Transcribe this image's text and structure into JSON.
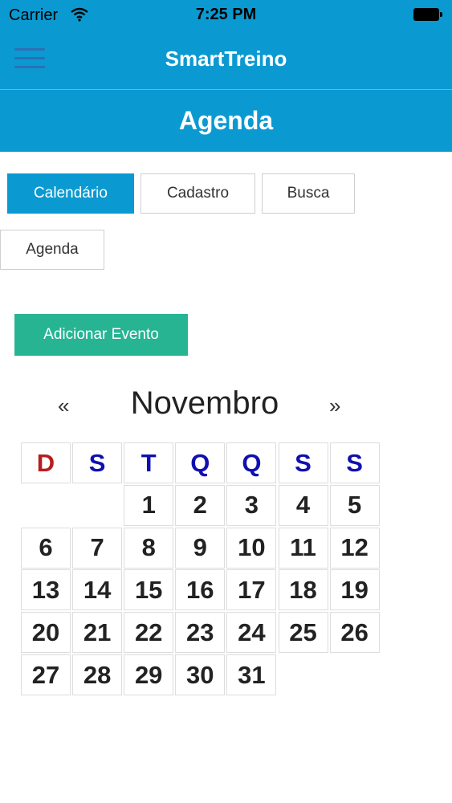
{
  "status_bar": {
    "carrier": "Carrier",
    "time": "7:25 PM"
  },
  "app": {
    "title": "SmartTreino"
  },
  "section": {
    "title": "Agenda"
  },
  "tabs": [
    {
      "label": "Calendário",
      "active": true
    },
    {
      "label": "Cadastro",
      "active": false
    },
    {
      "label": "Busca",
      "active": false
    },
    {
      "label": "Agenda",
      "active": false
    }
  ],
  "actions": {
    "add_event": "Adicionar Evento"
  },
  "calendar": {
    "prev": "«",
    "next": "»",
    "month": "Novembro",
    "weekdays": [
      "D",
      "S",
      "T",
      "Q",
      "Q",
      "S",
      "S"
    ],
    "first_weekday_index": 2,
    "days": [
      "1",
      "2",
      "3",
      "4",
      "5",
      "6",
      "7",
      "8",
      "9",
      "10",
      "11",
      "12",
      "13",
      "14",
      "15",
      "16",
      "17",
      "18",
      "19",
      "20",
      "21",
      "22",
      "23",
      "24",
      "25",
      "26",
      "27",
      "28",
      "29",
      "30",
      "31"
    ]
  },
  "colors": {
    "primary": "#0a9ad1",
    "accent_green": "#26b493",
    "weekday_blue": "#1010b0",
    "sunday_red": "#b81c1c"
  }
}
